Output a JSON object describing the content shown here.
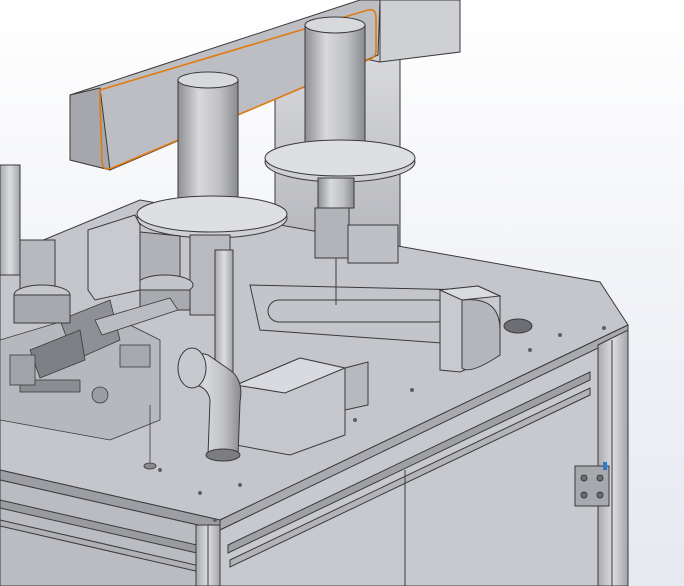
{
  "view": {
    "colors": {
      "background_top": "#ffffff",
      "background_bottom": "#e7e9f1",
      "metal_light": "#d6d7db",
      "metal_mid": "#b9babf",
      "metal_dark": "#8d8e93",
      "edge": "#3a3a3a",
      "selection_highlight": "#e07b12",
      "hinge_accent": "#2b7bd1"
    },
    "selected_part": "overhead-gantry-beam"
  }
}
